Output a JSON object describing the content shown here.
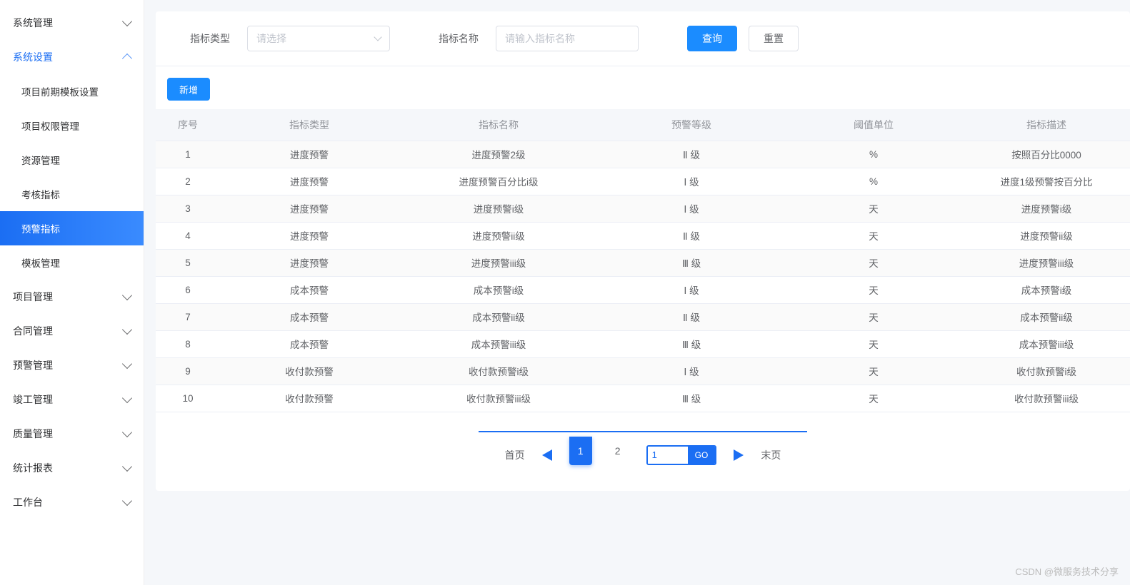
{
  "sidebar": {
    "groups": [
      {
        "label": "系统管理",
        "expanded": false,
        "items": []
      },
      {
        "label": "系统设置",
        "expanded": true,
        "active": true,
        "items": [
          {
            "label": "项目前期模板设置"
          },
          {
            "label": "项目权限管理"
          },
          {
            "label": "资源管理"
          },
          {
            "label": "考核指标"
          },
          {
            "label": "预警指标",
            "selected": true
          },
          {
            "label": "模板管理"
          }
        ]
      },
      {
        "label": "项目管理",
        "expanded": false,
        "items": []
      },
      {
        "label": "合同管理",
        "expanded": false,
        "items": []
      },
      {
        "label": "预警管理",
        "expanded": false,
        "items": []
      },
      {
        "label": "竣工管理",
        "expanded": false,
        "items": []
      },
      {
        "label": "质量管理",
        "expanded": false,
        "items": []
      },
      {
        "label": "统计报表",
        "expanded": false,
        "items": []
      },
      {
        "label": "工作台",
        "expanded": false,
        "items": []
      }
    ]
  },
  "filters": {
    "type_label": "指标类型",
    "type_placeholder": "请选择",
    "name_label": "指标名称",
    "name_placeholder": "请输入指标名称",
    "query_btn": "查询",
    "reset_btn": "重置"
  },
  "toolbar": {
    "add_btn": "新增"
  },
  "table": {
    "headers": [
      "序号",
      "指标类型",
      "指标名称",
      "预警等级",
      "阈值单位",
      "指标描述"
    ],
    "rows": [
      {
        "seq": "1",
        "type": "进度预警",
        "name": "进度预警2级",
        "level": "Ⅱ 级",
        "unit": "%",
        "desc": "按照百分比0000"
      },
      {
        "seq": "2",
        "type": "进度预警",
        "name": "进度预警百分比i级",
        "level": "Ⅰ 级",
        "unit": "%",
        "desc": "进度1级预警按百分比"
      },
      {
        "seq": "3",
        "type": "进度预警",
        "name": "进度预警i级",
        "level": "Ⅰ 级",
        "unit": "天",
        "desc": "进度预警i级"
      },
      {
        "seq": "4",
        "type": "进度预警",
        "name": "进度预警ii级",
        "level": "Ⅱ 级",
        "unit": "天",
        "desc": "进度预警ii级"
      },
      {
        "seq": "5",
        "type": "进度预警",
        "name": "进度预警iii级",
        "level": "Ⅲ 级",
        "unit": "天",
        "desc": "进度预警iii级"
      },
      {
        "seq": "6",
        "type": "成本预警",
        "name": "成本预警i级",
        "level": "Ⅰ 级",
        "unit": "天",
        "desc": "成本预警i级"
      },
      {
        "seq": "7",
        "type": "成本预警",
        "name": "成本预警ii级",
        "level": "Ⅱ 级",
        "unit": "天",
        "desc": "成本预警ii级"
      },
      {
        "seq": "8",
        "type": "成本预警",
        "name": "成本预警iii级",
        "level": "Ⅲ 级",
        "unit": "天",
        "desc": "成本预警iii级"
      },
      {
        "seq": "9",
        "type": "收付款预警",
        "name": "收付款预警i级",
        "level": "Ⅰ 级",
        "unit": "天",
        "desc": "收付款预警i级"
      },
      {
        "seq": "10",
        "type": "收付款预警",
        "name": "收付款预警iii级",
        "level": "Ⅲ 级",
        "unit": "天",
        "desc": "收付款预警iii级"
      }
    ]
  },
  "pagination": {
    "first": "首页",
    "last": "末页",
    "pages": [
      "1",
      "2"
    ],
    "current": "1",
    "go_value": "1",
    "go_label": "GO"
  },
  "watermark": "CSDN @微服务技术分享"
}
